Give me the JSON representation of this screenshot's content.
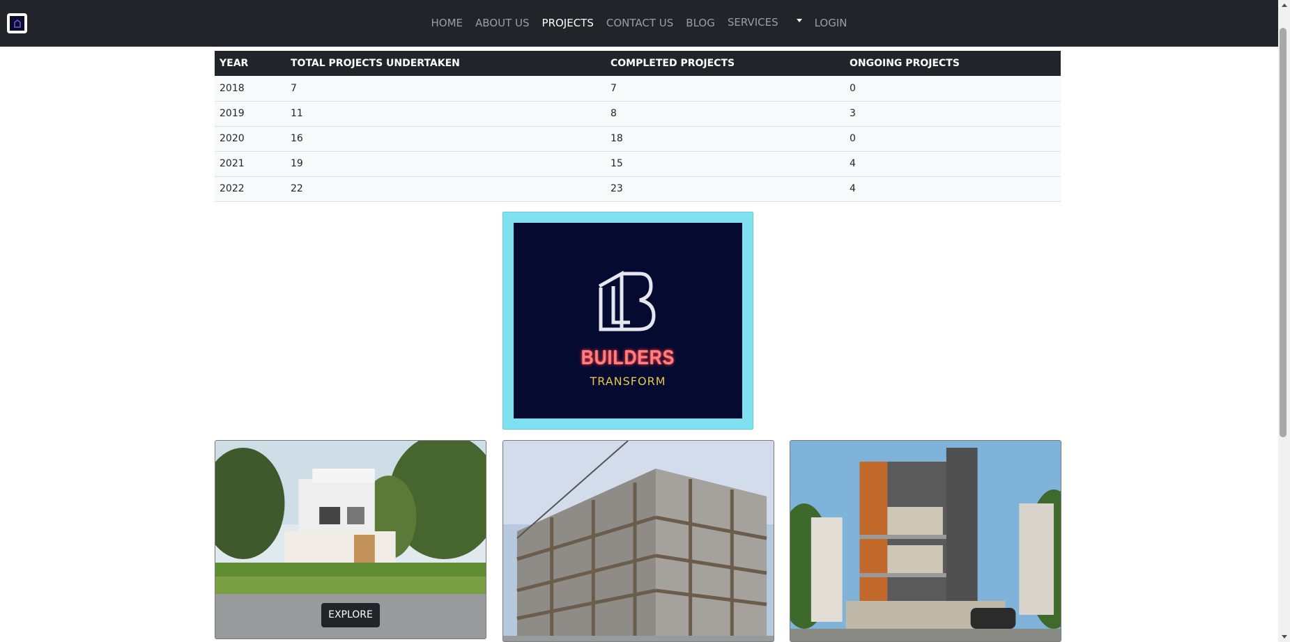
{
  "nav": {
    "brand_icon": "builders-logo-icon",
    "items": [
      {
        "label": "HOME",
        "active": false
      },
      {
        "label": "ABOUT US",
        "active": false
      },
      {
        "label": "PROJECTS",
        "active": true
      },
      {
        "label": "CONTACT US",
        "active": false
      },
      {
        "label": "BLOG",
        "active": false
      }
    ],
    "services_label": "SERVICES",
    "login_label": "LOGIN"
  },
  "table": {
    "headers": [
      "YEAR",
      "TOTAL PROJECTS UNDERTAKEN",
      "COMPLETED PROJECTS",
      "ONGOING PROJECTS"
    ],
    "rows": [
      [
        "2018",
        "7",
        "7",
        "0"
      ],
      [
        "2019",
        "11",
        "8",
        "3"
      ],
      [
        "2020",
        "16",
        "18",
        "0"
      ],
      [
        "2021",
        "19",
        "15",
        "4"
      ],
      [
        "2022",
        "22",
        "23",
        "4"
      ]
    ]
  },
  "logo": {
    "title": "BUILDERS",
    "subtitle": "TRANSFORM"
  },
  "cards": [
    {
      "image": "modern-house-photo",
      "button_label": "EXPLORE"
    },
    {
      "image": "building-under-construction-photo"
    },
    {
      "image": "modern-villa-photo"
    }
  ],
  "colors": {
    "navbar": "#212529",
    "logo_frame": "#7fe0ef",
    "logo_bg": "#050a30",
    "logo_title": "#ff8080",
    "logo_subtitle": "#e6c84a"
  }
}
